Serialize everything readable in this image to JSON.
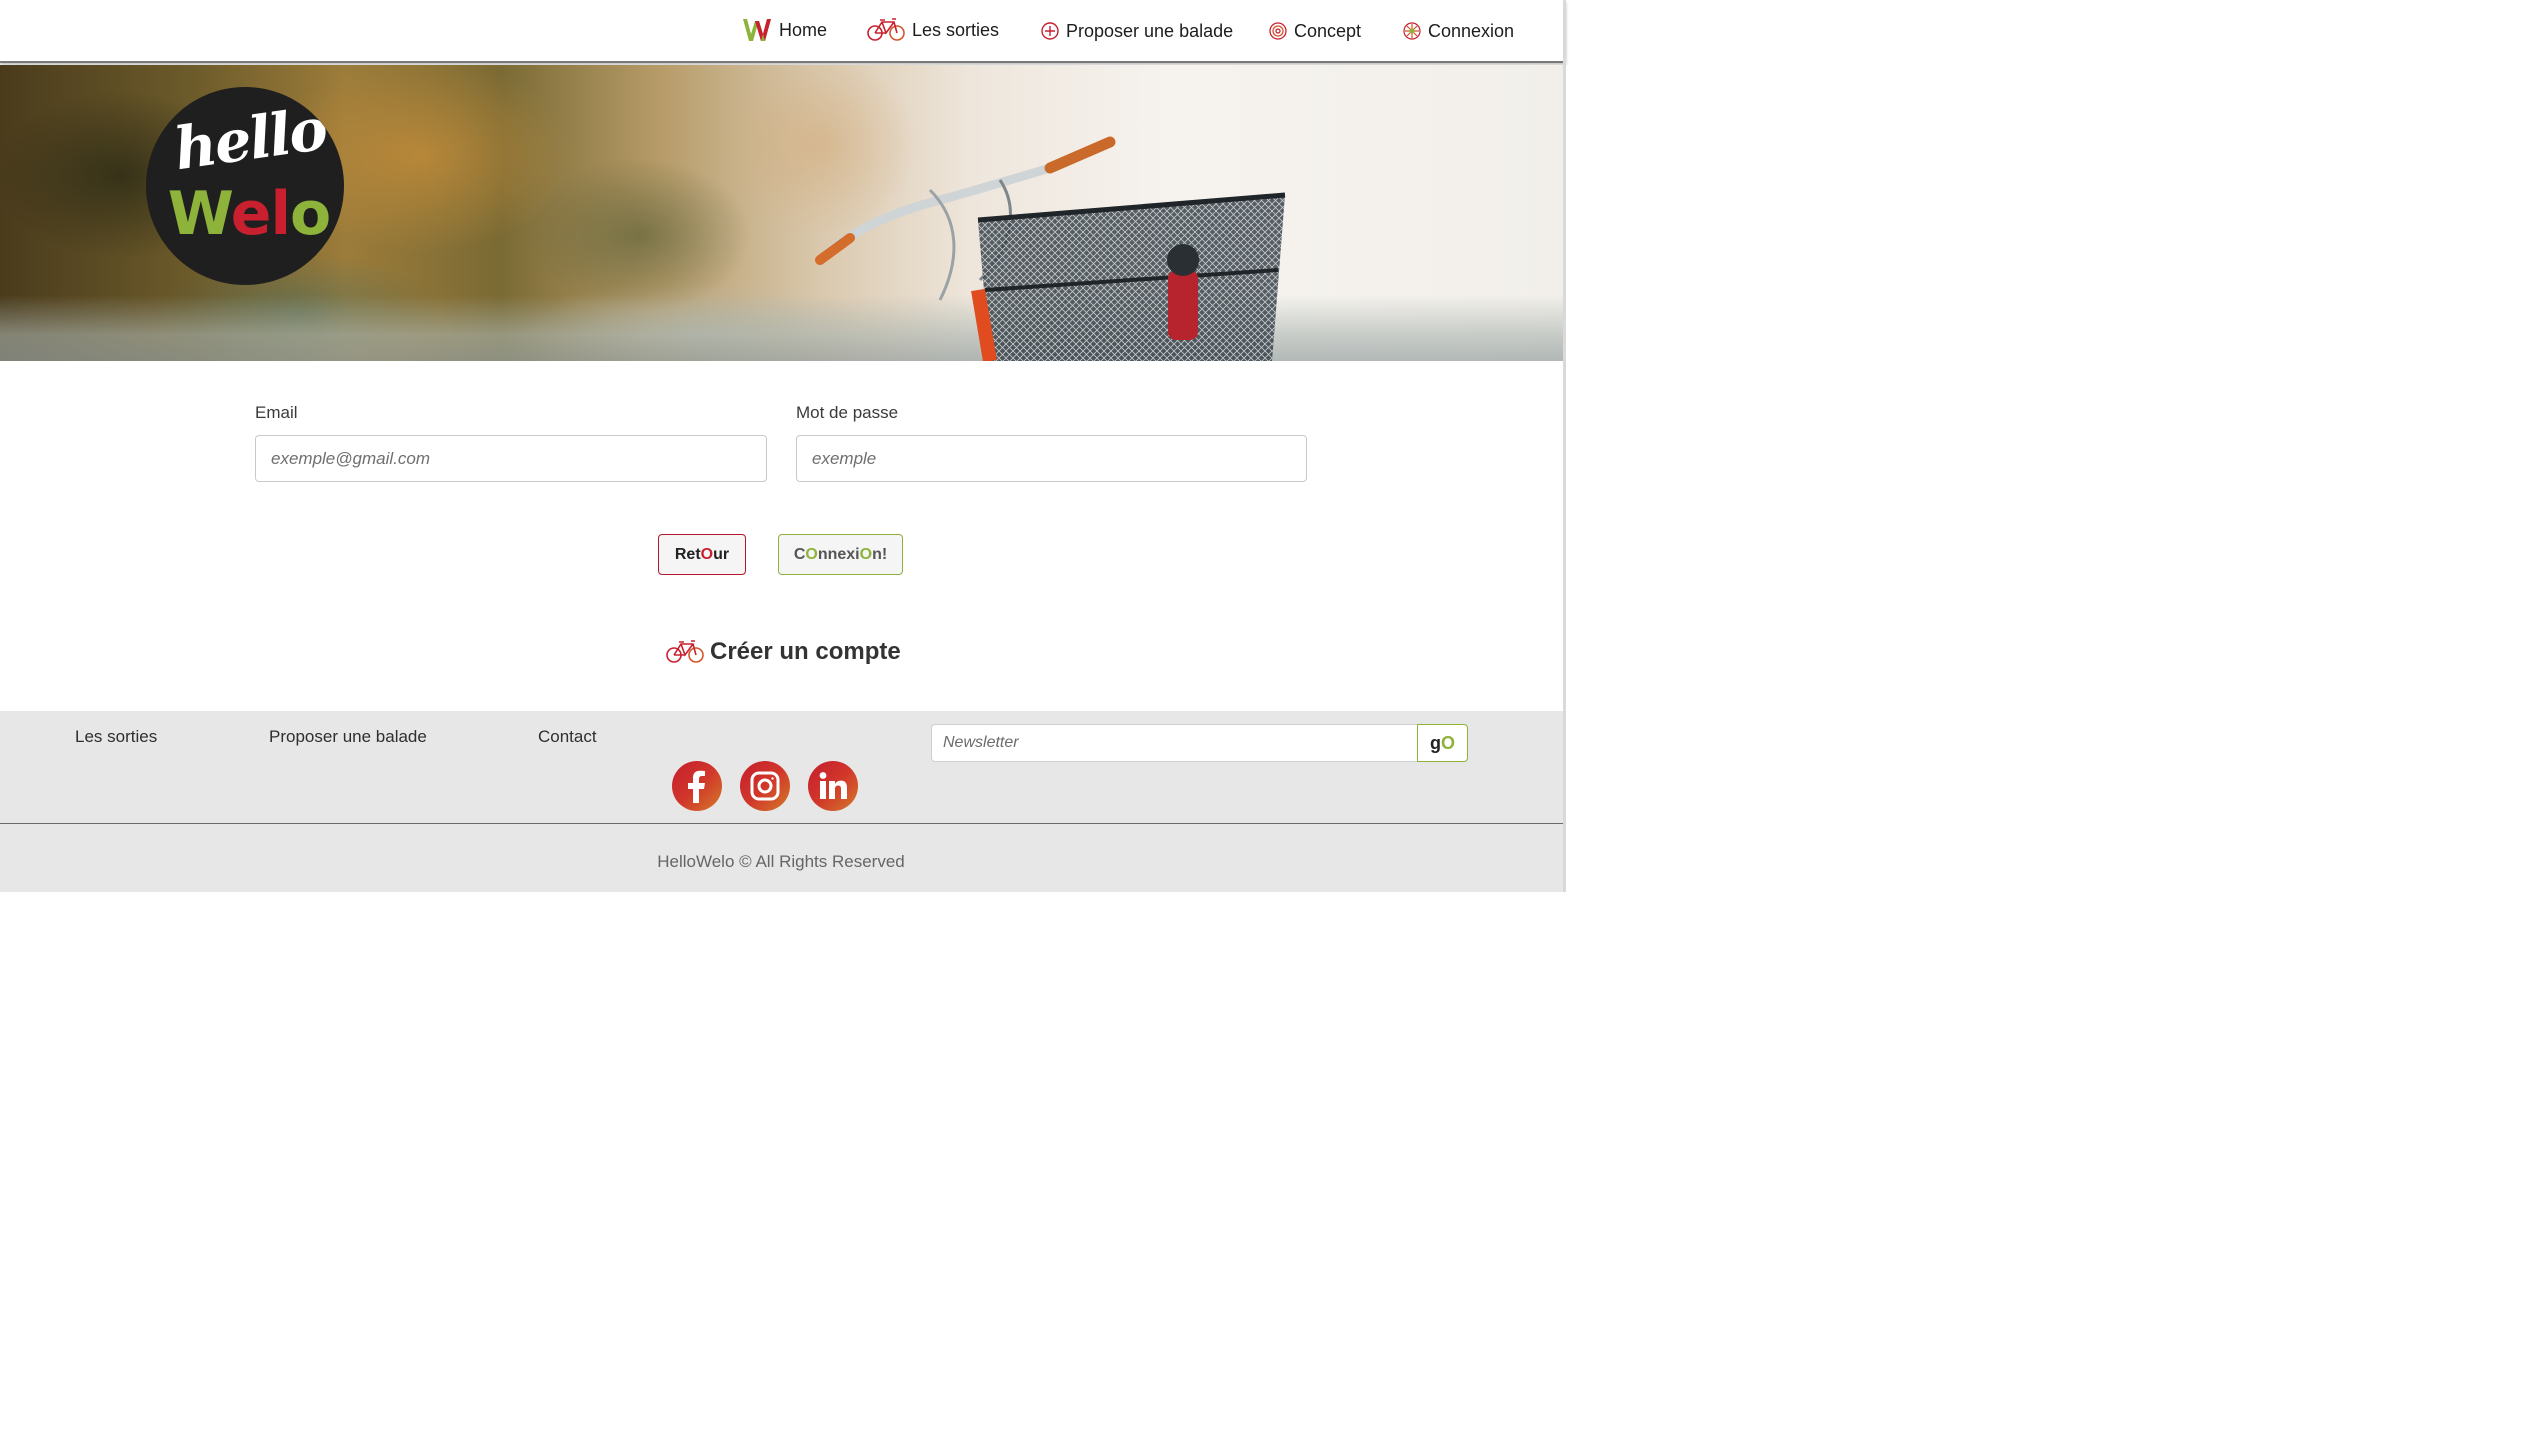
{
  "nav": {
    "items": [
      {
        "label": "Home",
        "icon": "welo-w-icon"
      },
      {
        "label": "Les sorties",
        "icon": "bicycle-icon"
      },
      {
        "label": "Proposer une balade",
        "icon": "plus-circle-icon"
      },
      {
        "label": "Concept",
        "icon": "at-circle-icon"
      },
      {
        "label": "Connexion",
        "icon": "sun-circle-icon"
      }
    ]
  },
  "hero": {
    "logo_hello": "hello",
    "logo_welo": [
      "W",
      "e",
      "l",
      "o"
    ]
  },
  "form": {
    "email_label": "Email",
    "email_placeholder": "exemple@gmail.com",
    "password_label": "Mot de passe",
    "password_placeholder": "exemple",
    "retour_parts": [
      "Ret",
      "O",
      "ur"
    ],
    "connexion_parts": [
      "C",
      "O",
      "nnexi",
      "O",
      "n!"
    ],
    "create_account": "Créer un compte"
  },
  "footer": {
    "links": [
      "Les sorties",
      "Proposer une balade",
      "Contact"
    ],
    "newsletter_placeholder": "Newsletter",
    "go_parts": [
      "g",
      "O"
    ],
    "social": [
      "facebook-icon",
      "instagram-icon",
      "linkedin-icon"
    ],
    "copyright": "HelloWelo © All Rights Reserved"
  },
  "colors": {
    "brand_red": "#c8202f",
    "brand_green": "#8db33a",
    "footer_bg": "#e7e7e8"
  }
}
